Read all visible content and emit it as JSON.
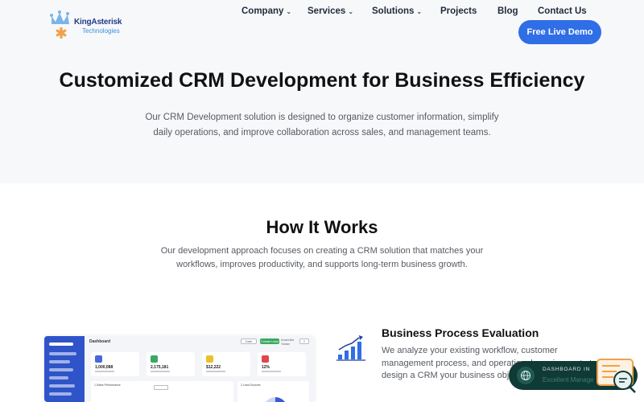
{
  "header": {
    "logo": {
      "brand": "KingAsterisk",
      "sub": "Technologies",
      "registered": "®"
    },
    "nav": [
      {
        "label": "Company",
        "dropdown": true
      },
      {
        "label": "Services",
        "dropdown": true
      },
      {
        "label": "Solutions",
        "dropdown": true
      },
      {
        "label": "Projects",
        "dropdown": false
      },
      {
        "label": "Blog",
        "dropdown": false
      },
      {
        "label": "Contact Us",
        "dropdown": false
      }
    ],
    "cta_label": "Free Live Demo"
  },
  "hero": {
    "title": "Customized CRM Development for Business Efficiency",
    "description": "Our CRM Development solution is designed to organize customer information, simplify daily operations, and improve collaboration across sales, and management teams."
  },
  "how_it_works": {
    "title": "How It Works",
    "description": "Our development approach focuses on creating a CRM solution that matches your workflows, improves productivity, and supports long-term business growth."
  },
  "dashboard_preview": {
    "title": "Dashboard",
    "controls": [
      "Date",
      "Create Lead",
      "Anandita Yadav"
    ],
    "cards": [
      {
        "value": "1,000,088",
        "color": "#4a66d9"
      },
      {
        "value": "2,175,181",
        "color": "#3aa864"
      },
      {
        "value": "$12,222",
        "color": "#e9c12f"
      },
      {
        "value": "12%",
        "color": "#e0474c"
      }
    ],
    "panels": [
      "1 Sales Performance",
      "2 Lead Sources"
    ]
  },
  "feature": {
    "icon": "growth-chart-icon",
    "title": "Business Process Evaluation",
    "description": "We analyze your existing workflow, customer management process, and operational requirements to design a CRM your business objectives."
  },
  "floating_widget": {
    "icon": "globe-icon",
    "line1": "DASHBOARD IN",
    "line2": "Excellent Manage"
  },
  "chat_icon": "chat-support-icon",
  "colors": {
    "primary": "#2f6ee6",
    "hero_bg": "#f7f8fa",
    "heading": "#111111",
    "body_text": "#555a61",
    "widget_bg": "#0f3a36",
    "chat_accent": "#f0a14a"
  }
}
